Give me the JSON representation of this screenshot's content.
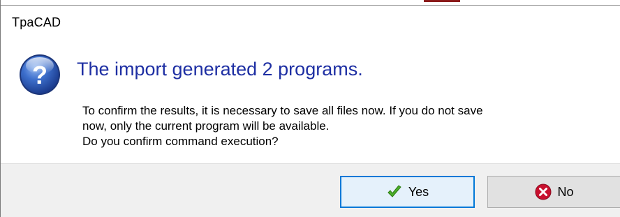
{
  "window": {
    "title": "TpaCAD"
  },
  "message": {
    "icon": "question-icon",
    "instruction": "The import generated 2 programs.",
    "content": "To confirm the results, it is necessary to save all files now. If you do not save\nnow, only the current program will be available.\nDo you confirm command execution?"
  },
  "buttons": {
    "yes_label": "Yes",
    "yes_icon": "checkmark-icon",
    "no_label": "No",
    "no_icon": "error-x-icon"
  },
  "colors": {
    "instruction_text": "#1e2fa3",
    "default_button_border": "#0078d7",
    "footer_background": "#f0f0f0"
  }
}
